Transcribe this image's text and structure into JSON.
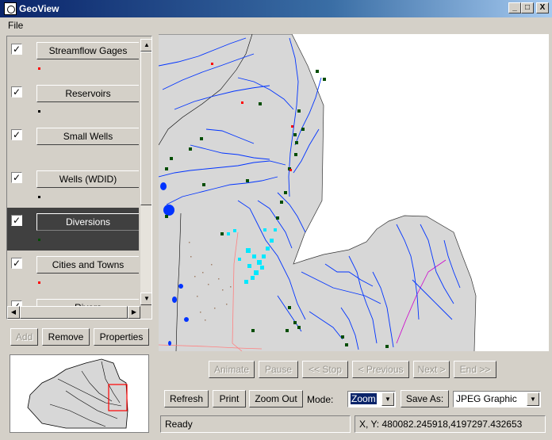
{
  "window": {
    "title": "GeoView",
    "controls": {
      "minimize": "_",
      "maximize": "□",
      "close": "X"
    }
  },
  "menu": {
    "file": "File"
  },
  "layers": [
    {
      "label": "Streamflow Gages",
      "checked": true,
      "selected": false,
      "symbol_color": "#ff0000"
    },
    {
      "label": "Reservoirs",
      "checked": true,
      "selected": false,
      "symbol_color": "#000000"
    },
    {
      "label": "Small Wells",
      "checked": true,
      "selected": false,
      "symbol_color": ""
    },
    {
      "label": "Wells (WDID)",
      "checked": true,
      "selected": false,
      "symbol_color": "#000000"
    },
    {
      "label": "Diversions",
      "checked": true,
      "selected": true,
      "symbol_color": "#004d00"
    },
    {
      "label": "Cities and Towns",
      "checked": true,
      "selected": false,
      "symbol_color": "#ff0000"
    },
    {
      "label": "Rivers",
      "checked": true,
      "selected": false,
      "symbol_color": ""
    }
  ],
  "checkmark": "✓",
  "layer_buttons": {
    "add": "Add",
    "remove": "Remove",
    "properties": "Properties"
  },
  "animation": {
    "animate": "Animate",
    "pause": "Pause",
    "stop": "<< Stop",
    "previous": "< Previous",
    "next": "Next >",
    "end": "End >>"
  },
  "toolbar": {
    "refresh": "Refresh",
    "print": "Print",
    "zoom_out": "Zoom Out",
    "mode_label": "Mode:",
    "mode_value": "Zoom",
    "save_as": "Save As:",
    "format_value": "JPEG Graphic"
  },
  "status": {
    "message": "Ready",
    "coords": "X, Y:  480082.245918,4197297.432653"
  },
  "colors": {
    "map_land": "#d7d7d7",
    "river": "#0033ff",
    "diversion": "#004d00",
    "well": "#00ffff",
    "boundary": "#ff8080",
    "selection_bg": "#404040"
  }
}
